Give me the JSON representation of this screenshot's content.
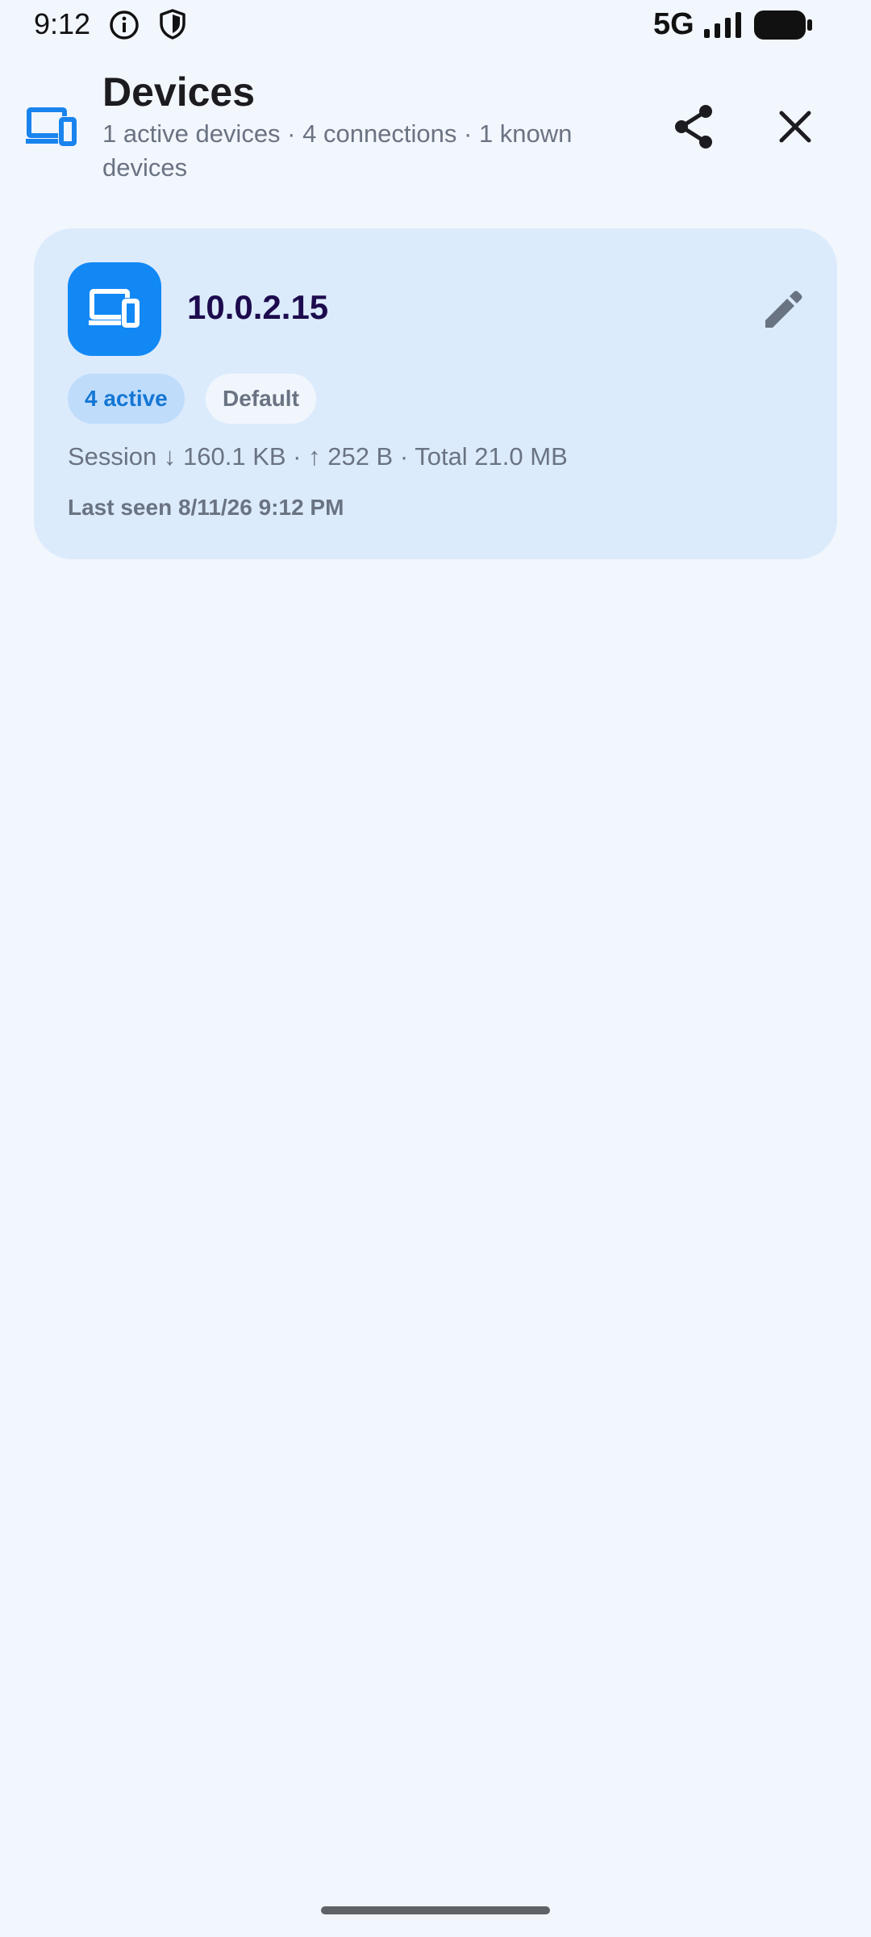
{
  "status_bar": {
    "time": "9:12",
    "network": "5G",
    "icons": [
      "info-icon",
      "shield-icon",
      "signal-icon",
      "battery-icon"
    ]
  },
  "header": {
    "title": "Devices",
    "subtitle": "1 active devices · 4 connections · 1 known devices",
    "icon": "devices-icon",
    "actions": [
      "share-icon",
      "close-icon"
    ]
  },
  "devices": [
    {
      "name": "10.0.2.15",
      "icon": "devices-icon",
      "badges": {
        "active": "4 active",
        "default": "Default"
      },
      "stats": "Session ↓ 160.1 KB · ↑ 252 B · Total 21.0 MB",
      "last_seen": "Last seen 8/11/26 9:12 PM"
    }
  ],
  "colors": {
    "background": "#f2f6fd",
    "accent": "#1288f5",
    "card": "#dcebfc",
    "device_name": "#1d0b4e",
    "muted_text": "#6a7382"
  }
}
